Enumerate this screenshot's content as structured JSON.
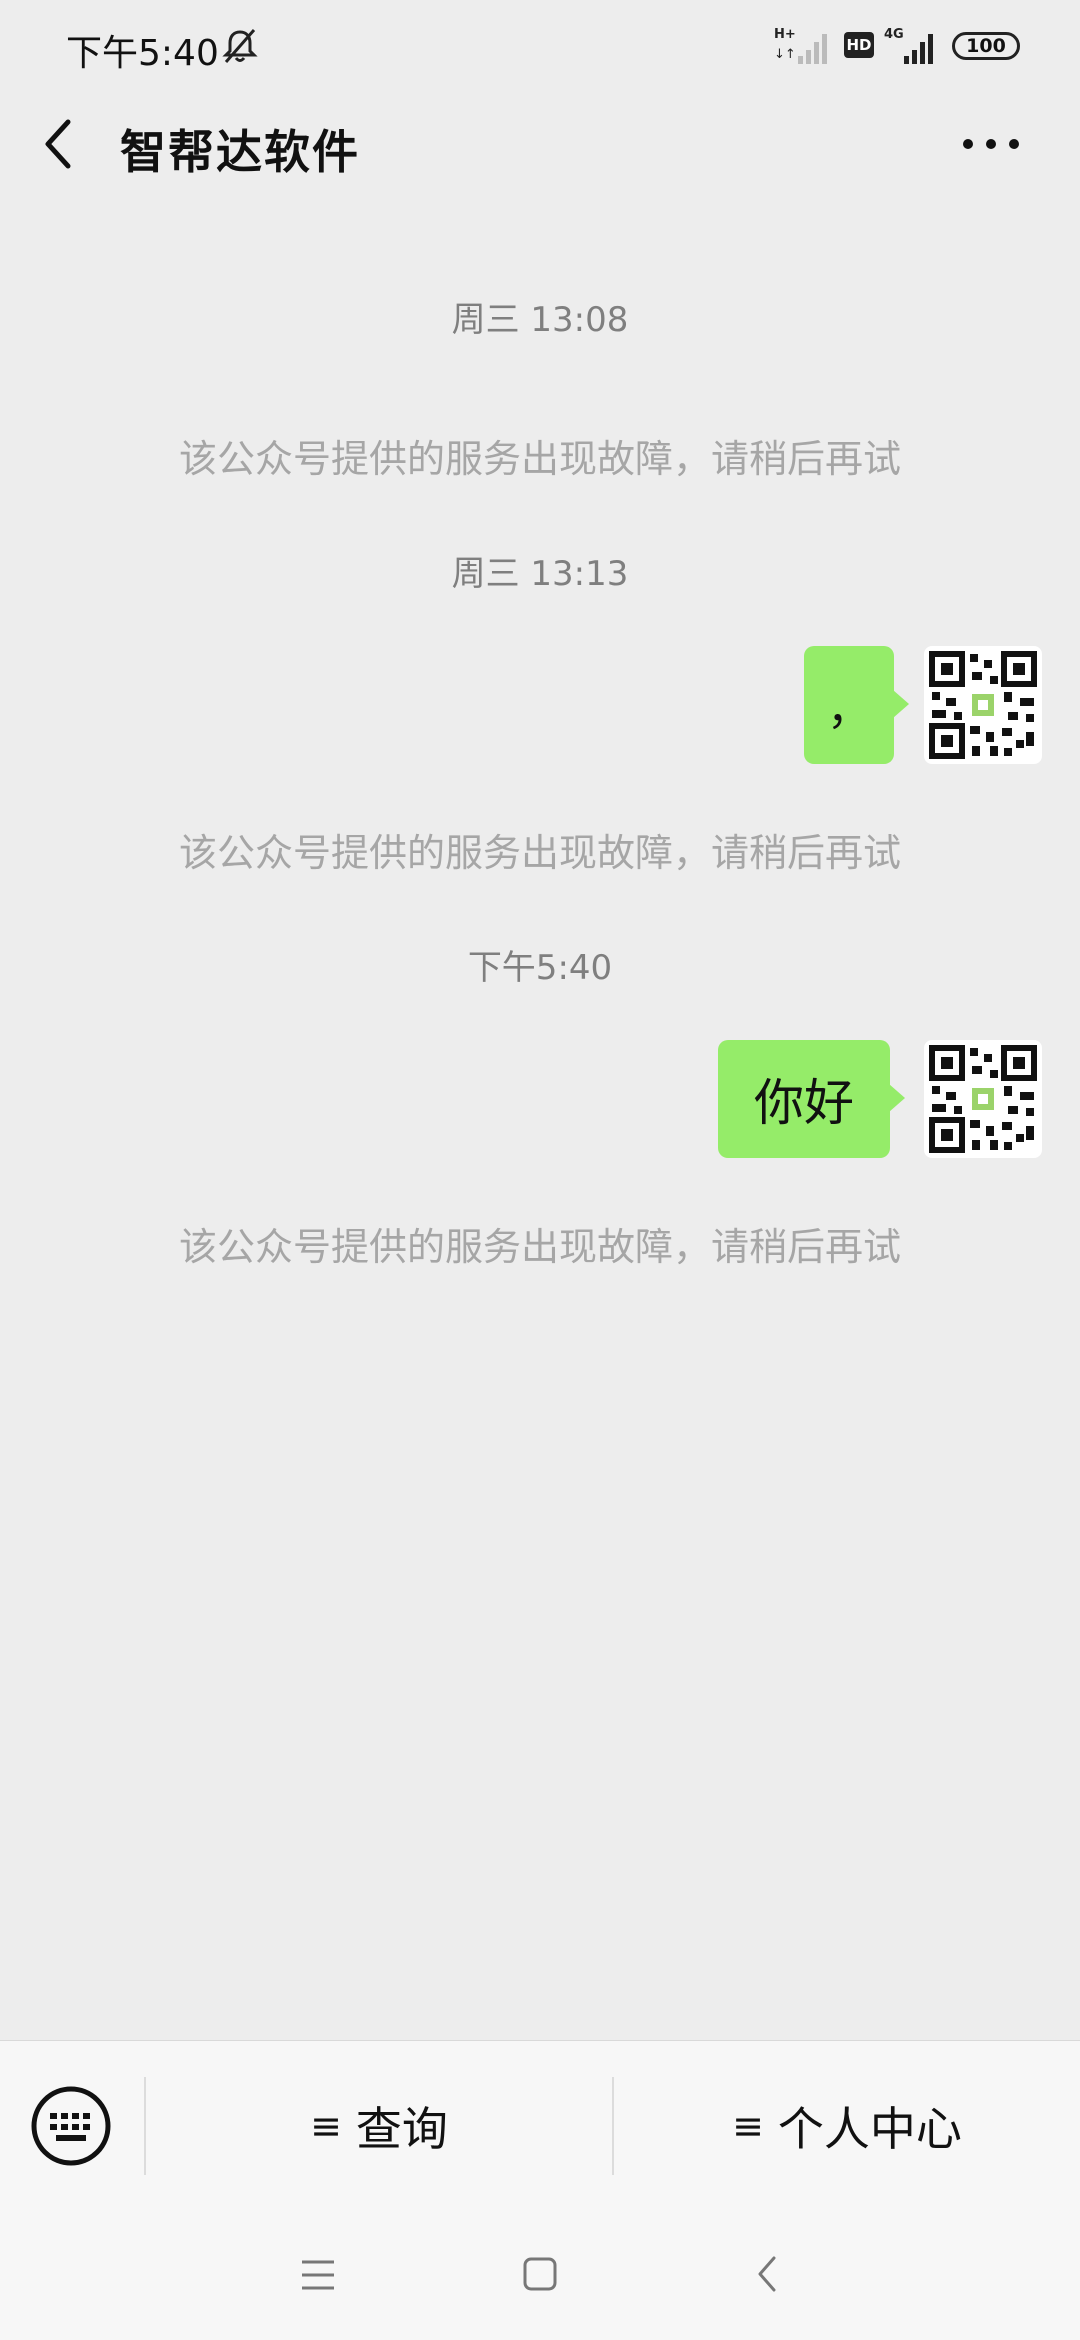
{
  "status_bar": {
    "time": "下午5:40",
    "network_label": "H+",
    "hd_label": "HD",
    "net2_label": "4G",
    "battery": "100"
  },
  "header": {
    "title": "智帮达软件"
  },
  "messages": [
    {
      "kind": "timestamp",
      "text": "周三 13:08"
    },
    {
      "kind": "system",
      "text": "该公众号提供的服务出现故障，请稍后再试"
    },
    {
      "kind": "timestamp",
      "text": "周三 13:13"
    },
    {
      "kind": "outgoing",
      "text": "，"
    },
    {
      "kind": "system",
      "text": "该公众号提供的服务出现故障，请稍后再试"
    },
    {
      "kind": "timestamp",
      "text": "下午5:40"
    },
    {
      "kind": "outgoing",
      "text": "你好"
    },
    {
      "kind": "system",
      "text": "该公众号提供的服务出现故障，请稍后再试"
    }
  ],
  "bottom_menu": {
    "items": [
      {
        "icon": "≡",
        "label": "查询"
      },
      {
        "icon": "≡",
        "label": "个人中心"
      }
    ]
  },
  "colors": {
    "bubble": "#95ec69",
    "background": "#ededed"
  }
}
